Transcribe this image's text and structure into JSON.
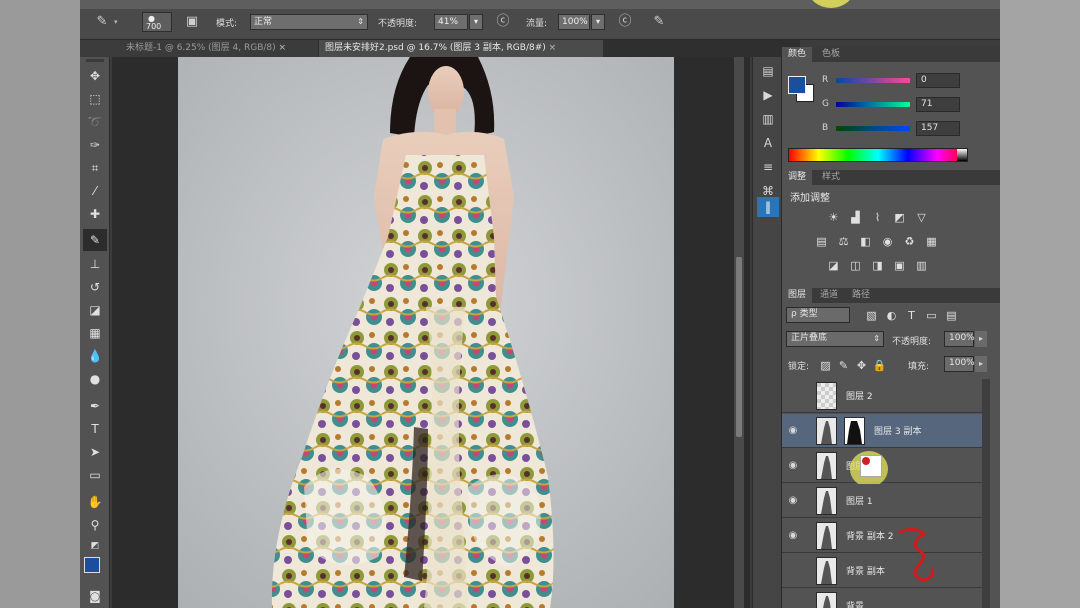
{
  "options_bar": {
    "brush_size": "700",
    "mode_label": "模式:",
    "mode_value": "正常",
    "opacity_label": "不透明度:",
    "opacity_value": "41%",
    "flow_label": "流量:",
    "flow_value": "100%"
  },
  "doc_tabs": [
    {
      "label": "未标题-1 @ 6.25% (图层 4, RGB/8)",
      "close": "×"
    },
    {
      "label": "图层未安排好2.psd @ 16.7% (图层 3 副本, RGB/8#)",
      "close": "×"
    }
  ],
  "color_panel": {
    "tabs": [
      "颜色",
      "色板"
    ],
    "fg_color": "#1b4f9d",
    "bg_color": "#ffffff",
    "channels": [
      {
        "label": "R",
        "value": "0"
      },
      {
        "label": "G",
        "value": "71"
      },
      {
        "label": "B",
        "value": "157"
      }
    ]
  },
  "adjust_panel": {
    "tabs": [
      "调整",
      "样式"
    ],
    "title": "添加调整"
  },
  "layers_panel": {
    "tabs": [
      "图层",
      "通道",
      "路径"
    ],
    "kind_filter": "ρ 类型",
    "blend_mode": "正片叠底",
    "opacity_label": "不透明度:",
    "opacity_value": "100%",
    "lock_label": "锁定:",
    "fill_label": "填充:",
    "fill_value": "100%",
    "layers": [
      {
        "name": "图层 2",
        "visible": false,
        "selected": false
      },
      {
        "name": "图层 3 副本",
        "visible": true,
        "selected": true,
        "has_mask": true
      },
      {
        "name": "图层",
        "visible": true,
        "selected": false
      },
      {
        "name": "图层 1",
        "visible": true,
        "selected": false
      },
      {
        "name": "背景 副本 2",
        "visible": true,
        "selected": false
      },
      {
        "name": "背景 副本",
        "visible": false,
        "selected": false
      },
      {
        "name": "背景",
        "visible": false,
        "selected": false
      }
    ]
  },
  "accent_colors": {
    "cursor_highlight": "#e6e35a",
    "selected_layer": "#56667c"
  }
}
